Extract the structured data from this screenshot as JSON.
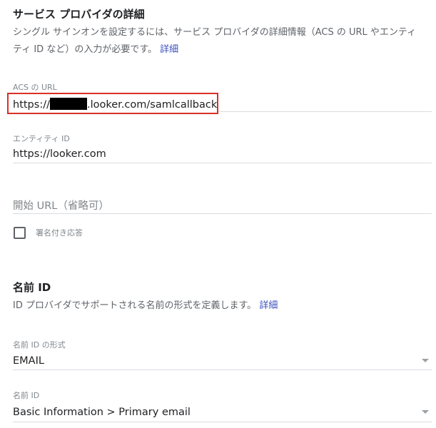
{
  "sp_details": {
    "title": "サービス プロバイダの詳細",
    "description_line1": "シングル サインオンを設定するには、サービス プロバイダの詳細情報（ACS の URL やエンティ",
    "description_line2": "ティ ID など）の入力が必要です。",
    "learn_more": "詳細",
    "acs_url": {
      "label": "ACS の URL",
      "value_prefix": "https://",
      "value_suffix": ".looker.com/samlcallback"
    },
    "entity_id": {
      "label": "エンティティ ID",
      "value": "https://looker.com"
    },
    "start_url": {
      "placeholder": "開始 URL（省略可）"
    },
    "signed_response": {
      "label": "署名付き応答",
      "checked": false
    }
  },
  "name_id": {
    "title": "名前 ID",
    "description": "ID プロバイダでサポートされる名前の形式を定義します。",
    "learn_more": "詳細",
    "format": {
      "label": "名前 ID の形式",
      "value": "EMAIL"
    },
    "name": {
      "label": "名前 ID",
      "value": "Basic Information > Primary email"
    }
  }
}
